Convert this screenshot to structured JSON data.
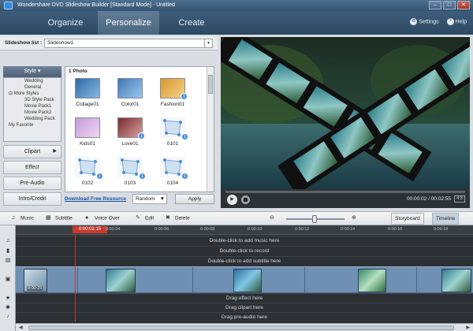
{
  "window": {
    "title": "Wondershare DVD Slideshow Builder [Standard Mode] - Untitled",
    "controls": [
      "–",
      "□",
      "✕"
    ]
  },
  "nav": {
    "tabs": [
      {
        "label": "Organize",
        "active": false
      },
      {
        "label": "Personalize",
        "active": true
      },
      {
        "label": "Create",
        "active": false
      }
    ],
    "settings_label": "Settings",
    "help_label": "Help"
  },
  "slideshow_list": {
    "label": "Slideshow list :",
    "value": "Slideshow1"
  },
  "style_panel": {
    "header": "Style",
    "items": [
      "Wedding",
      "General",
      "⊟ More Styles",
      "3D Style Pack",
      "Movie Pack1",
      "Movie Pack2",
      "Wedding Pack",
      "My Favorite"
    ]
  },
  "side_buttons": [
    "Clipart",
    "Effect",
    "Pre-Audio",
    "Intro/Credit"
  ],
  "photos": {
    "header": "1 Photo",
    "items": [
      {
        "label": "Collage01",
        "badge": "",
        "colors": [
          "#2e6aa8",
          "#87b9e0"
        ]
      },
      {
        "label": "Color01",
        "badge": "",
        "colors": [
          "#3f78b8",
          "#9ec6ea"
        ]
      },
      {
        "label": "Fashion01",
        "badge": "1",
        "colors": [
          "#d8952c",
          "#f3d58c"
        ]
      },
      {
        "label": "Kids01",
        "badge": "",
        "colors": [
          "#c49ad8",
          "#f0d7f3"
        ]
      },
      {
        "label": "Love01",
        "badge": "1",
        "colors": [
          "#7b2b2b",
          "#d8a0a0"
        ]
      },
      {
        "label": "0101",
        "badge": "1",
        "colors": []
      },
      {
        "label": "0102",
        "badge": "1",
        "colors": []
      },
      {
        "label": "0103",
        "badge": "1",
        "colors": []
      },
      {
        "label": "0104",
        "badge": "1",
        "colors": []
      }
    ]
  },
  "bottom": {
    "download_link": "Download Free Resource",
    "random_value": "Random",
    "apply_label": "Apply"
  },
  "player": {
    "time": "00:00:02 / 00:02:55",
    "ratio": "4:3"
  },
  "toolbar": {
    "music": "Music",
    "subtitle": "Subtitle",
    "voice_over": "Voice Over",
    "edit": "Edit",
    "delete": "Delete",
    "storyboard": "Storyboard",
    "timeline": "Timeline"
  },
  "timeline": {
    "playhead": "0:00:02.15",
    "ticks": [
      "0:00:04",
      "0:00:06",
      "0:00:08",
      "0:00:10",
      "0:00:12",
      "0:00:14",
      "0:00:16",
      "0:00:18"
    ],
    "hints": {
      "music": "Double-click to add music here",
      "record": "Double-click to record",
      "subtitle": "Double-click to add subtitle here",
      "effect": "Drag effect here",
      "clipart": "Drag clipart here",
      "pre_audio": "Drag pre-audio here"
    },
    "first_clip_time": "0:00:29"
  },
  "icons": {
    "app": "app-logo-icon",
    "settings": "gear-icon",
    "help": "help-icon",
    "music": "music-note-icon",
    "subtitle": "subtitle-icon",
    "voice": "microphone-icon",
    "edit": "pencil-icon",
    "delete": "trash-icon",
    "zoom_out": "zoom-out-icon",
    "zoom_in": "zoom-in-icon"
  },
  "colors": {
    "accent": "#4d90d8",
    "playhead": "#c83a2e",
    "nav": "#35536f"
  }
}
